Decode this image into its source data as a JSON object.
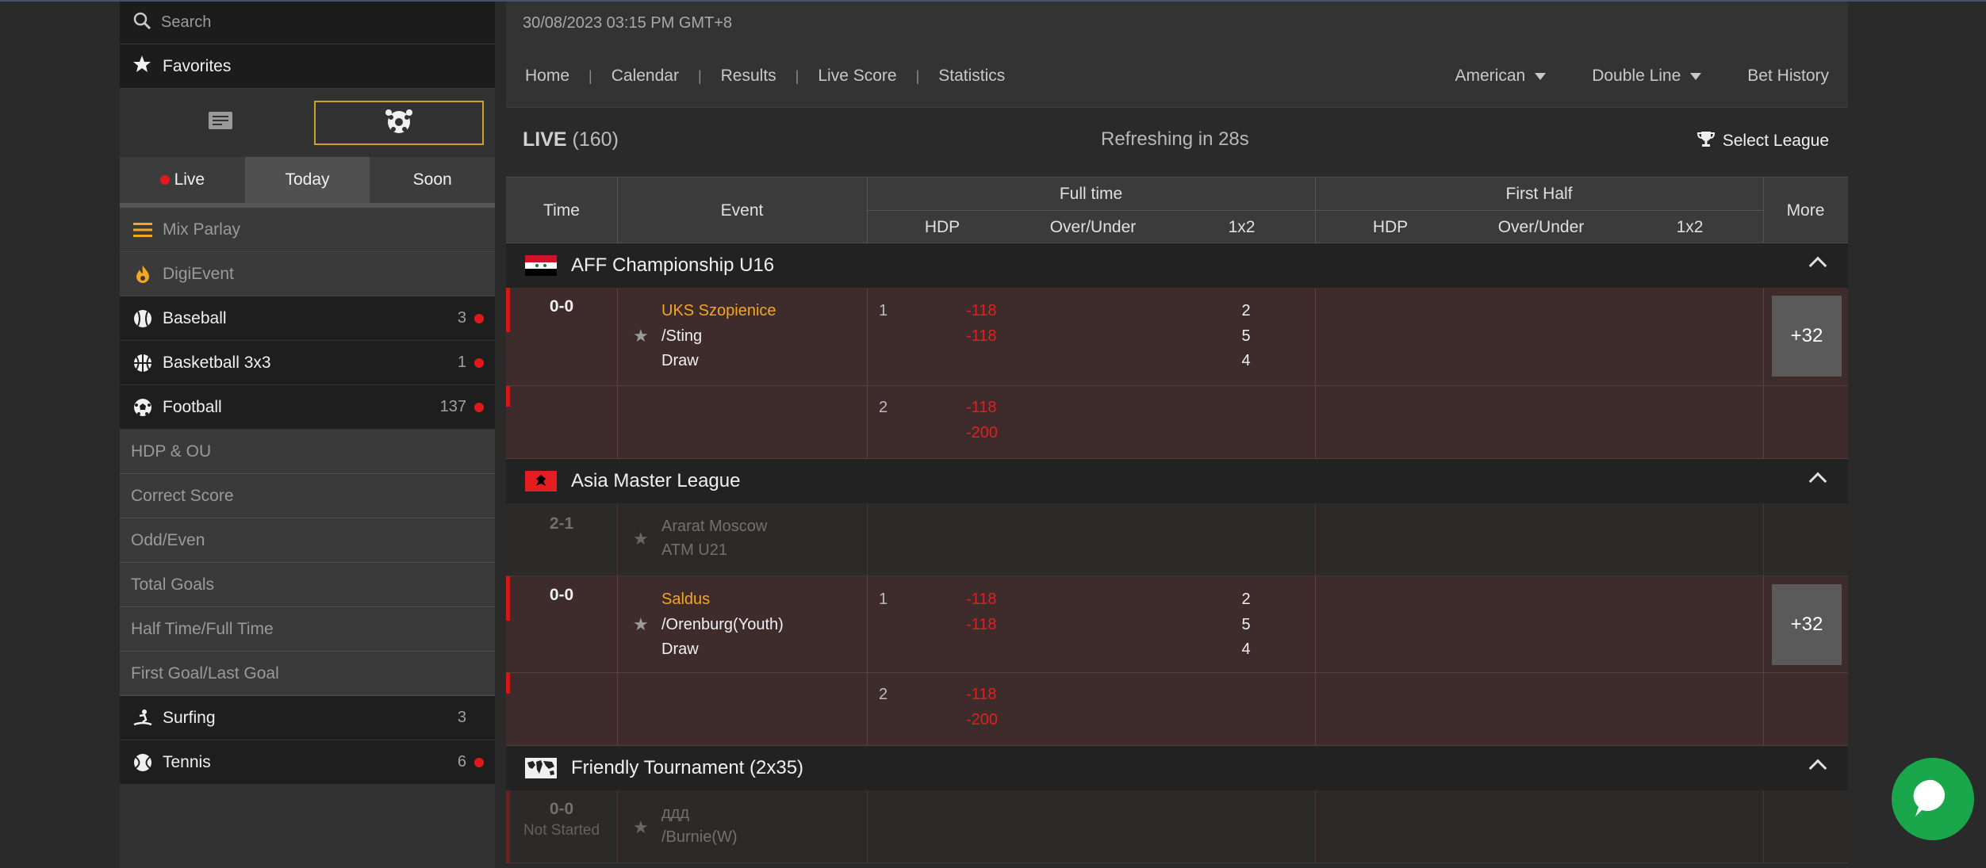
{
  "sidebar": {
    "search_placeholder": "Search",
    "favorites_label": "Favorites",
    "tabs": [
      {
        "label": "Live",
        "live_dot": true
      },
      {
        "label": "Today"
      },
      {
        "label": "Soon"
      }
    ],
    "special_items": [
      {
        "label": "Mix Parlay",
        "icon": "menu-icon"
      },
      {
        "label": "DigiEvent",
        "icon": "flame-icon"
      }
    ],
    "sports": [
      {
        "label": "Baseball",
        "count": "3",
        "live": true,
        "icon": "baseball-icon"
      },
      {
        "label": "Basketball 3x3",
        "count": "1",
        "live": true,
        "icon": "basketball-icon"
      },
      {
        "label": "Football",
        "count": "137",
        "live": true,
        "icon": "football-icon"
      }
    ],
    "football_subitems": [
      "HDP & OU",
      "Correct Score",
      "Odd/Even",
      "Total Goals",
      "Half Time/Full Time",
      "First Goal/Last Goal"
    ],
    "sports_after": [
      {
        "label": "Surfing",
        "count": "3",
        "live": false,
        "icon": "surfing-icon"
      },
      {
        "label": "Tennis",
        "count": "6",
        "live": true,
        "icon": "tennis-icon"
      }
    ]
  },
  "header": {
    "datetime": "30/08/2023 03:15 PM GMT+8",
    "nav": [
      "Home",
      "Calendar",
      "Results",
      "Live Score",
      "Statistics"
    ],
    "odds_format": "American",
    "line_mode": "Double Line",
    "bet_history": "Bet History"
  },
  "live": {
    "label": "LIVE",
    "count": "(160)",
    "refresh_text": "Refreshing in 28s",
    "select_league": "Select League"
  },
  "table_headers": {
    "time": "Time",
    "event": "Event",
    "full_time": "Full time",
    "first_half": "First Half",
    "more": "More",
    "hdp": "HDP",
    "over_under": "Over/Under",
    "x12": "1x2"
  },
  "leagues": [
    {
      "name": "AFF Championship U16",
      "flag": "syria-flag",
      "match": {
        "score": "0-0",
        "home": "UKS Szopienice",
        "away": "/Sting",
        "draw": "Draw",
        "line1_no": "1",
        "line1_odds": [
          "-118",
          "-118"
        ],
        "x12": [
          "2",
          "5",
          "4"
        ],
        "line2_no": "2",
        "line2_odds": [
          "-118",
          "-200"
        ],
        "more": "+32"
      }
    },
    {
      "name": "Asia Master League",
      "flag": "albania-flag",
      "faded_match": {
        "score": "2-1",
        "home": "Ararat Moscow",
        "away": "ATM U21"
      },
      "match": {
        "score": "0-0",
        "home": "Saldus",
        "away": "/Orenburg(Youth)",
        "draw": "Draw",
        "line1_no": "1",
        "line1_odds": [
          "-118",
          "-118"
        ],
        "x12": [
          "2",
          "5",
          "4"
        ],
        "line2_no": "2",
        "line2_odds": [
          "-118",
          "-200"
        ],
        "more": "+32"
      }
    },
    {
      "name": "Friendly Tournament (2x35)",
      "flag": "world-map-flag",
      "faded_match": {
        "score": "0-0",
        "status": "Not Started",
        "home": "ддд",
        "away": "/Burnie(W)"
      }
    }
  ],
  "colors": {
    "accent": "#c9a22a",
    "odds": "#e02020",
    "home_team": "#f3a524",
    "live_dot": "#e31919",
    "chat": "#1aa64b"
  }
}
